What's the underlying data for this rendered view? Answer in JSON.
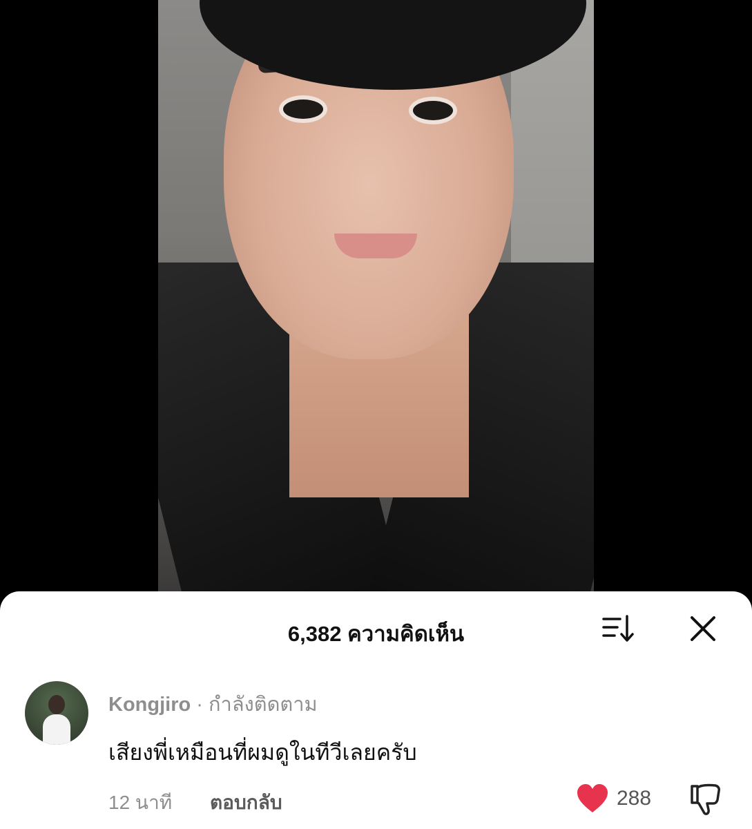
{
  "comments_panel": {
    "count_label": "6,382 ความคิดเห็น",
    "sort_icon": "sort-descending-icon",
    "close_icon": "close-icon"
  },
  "comment": {
    "username": "Kongjiro",
    "separator": " · ",
    "follow_status": "กำลังติดตาม",
    "text": "เสียงพี่เหมือนที่ผมดูในทีวีเลยครับ",
    "time": "12 นาที",
    "reply_label": "ตอบกลับ",
    "like_count": "288",
    "like_color": "#e8334f"
  }
}
